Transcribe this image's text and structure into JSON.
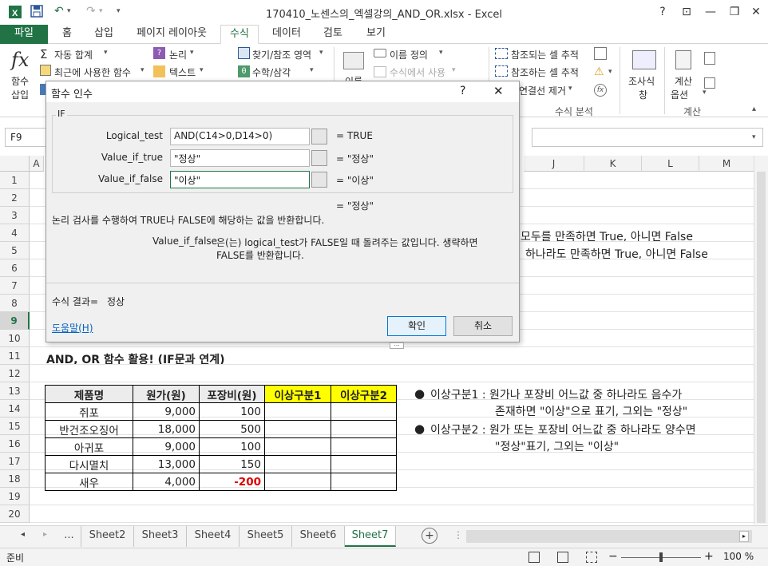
{
  "window": {
    "title": "170410_노센스의_엑셀강의_AND_OR.xlsx - Excel",
    "help": "?",
    "buttons": {
      "ribbon_display": "⊡",
      "minimize": "—",
      "restore": "❐",
      "close": "✕"
    }
  },
  "ribbon_tabs": [
    "파일",
    "홈",
    "삽입",
    "페이지 레이아웃",
    "수식",
    "데이터",
    "검토",
    "보기"
  ],
  "ribbon": {
    "insert_function": {
      "label1": "함수",
      "label2": "삽입"
    },
    "autosum": "자동 합계",
    "recent": "최근에 사용한 함수",
    "logical": "논리",
    "text": "텍스트",
    "lookup": "찾기/참조 영역",
    "math": "수학/삼각",
    "name_define": "이름 정의",
    "use_in_formula": "수식에서 사용",
    "name_manager": "이름",
    "trace_precedents": "참조되는 셀 추적",
    "trace_dependents": "참조하는 셀 추적",
    "remove_arrows": "연결선 제거",
    "audit_group": "수식 분석",
    "watch1": "조사식",
    "watch2": "창",
    "calc_opts1": "계산",
    "calc_opts2": "옵션",
    "calc_group": "계산"
  },
  "namebox": "F9",
  "columns": [
    "A",
    "J",
    "K",
    "L",
    "M"
  ],
  "rows": [
    "1",
    "2",
    "3",
    "4",
    "5",
    "6",
    "7",
    "8",
    "9",
    "10",
    "11",
    "12",
    "13",
    "14",
    "15",
    "16",
    "17",
    "18",
    "19",
    "20"
  ],
  "sheet_text": {
    "and_desc": "모두를 만족하면 True, 아니면 False",
    "or_desc": "하나라도 만족하면 True, 아니면 False",
    "section_title": "AND, OR 함수 활용! (IF문과 연계)",
    "note1_line1": "이상구분1 : 원가나 포장비 어느값 중 하나라도 음수가",
    "note1_line2": "존재하면 \"이상\"으로 표기, 그외는 \"정상\"",
    "note2_line1": "이상구분2 : 원가 또는 포장비 어느값 중 하나라도 양수면",
    "note2_line2": "\"정상\"표기, 그외는 \"이상\""
  },
  "table": {
    "headers": [
      "제품명",
      "원가(원)",
      "포장비(원)",
      "이상구분1",
      "이상구분2"
    ],
    "rows": [
      {
        "name": "쥐포",
        "cost": "9,000",
        "pack": "100"
      },
      {
        "name": "반건조오징어",
        "cost": "18,000",
        "pack": "500"
      },
      {
        "name": "아귀포",
        "cost": "9,000",
        "pack": "100"
      },
      {
        "name": "다시멸치",
        "cost": "13,000",
        "pack": "150"
      },
      {
        "name": "새우",
        "cost": "4,000",
        "pack": "-200"
      }
    ]
  },
  "dialog": {
    "title": "함수 인수",
    "help": "?",
    "close": "✕",
    "function_name": "IF",
    "args": [
      {
        "label": "Logical_test",
        "value": "AND(C14>0,D14>0)",
        "result": "=  TRUE"
      },
      {
        "label": "Value_if_true",
        "value": "\"정상\"",
        "result": "=  \"정상\""
      },
      {
        "label": "Value_if_false",
        "value": "\"이상\"",
        "result": "=  \"이상\""
      }
    ],
    "overall_result": "=  \"정상\"",
    "description": "논리 검사를 수행하여 TRUE나 FALSE에 해당하는 값을 반환합니다.",
    "arg_help_name": "Value_if_false",
    "arg_help_line1": "은(는) logical_test가 FALSE일 때 돌려주는 값입니다. 생략하면",
    "arg_help_line2": "FALSE를 반환합니다.",
    "formula_result_label": "수식 결과=",
    "formula_result_value": "정상",
    "help_link": "도움말(H)",
    "ok": "확인",
    "cancel": "취소"
  },
  "sheet_tabs": [
    "...",
    "Sheet2",
    "Sheet3",
    "Sheet4",
    "Sheet5",
    "Sheet6",
    "Sheet7"
  ],
  "active_sheet": "Sheet7",
  "status": {
    "ready": "준비",
    "zoom": "100 %"
  }
}
